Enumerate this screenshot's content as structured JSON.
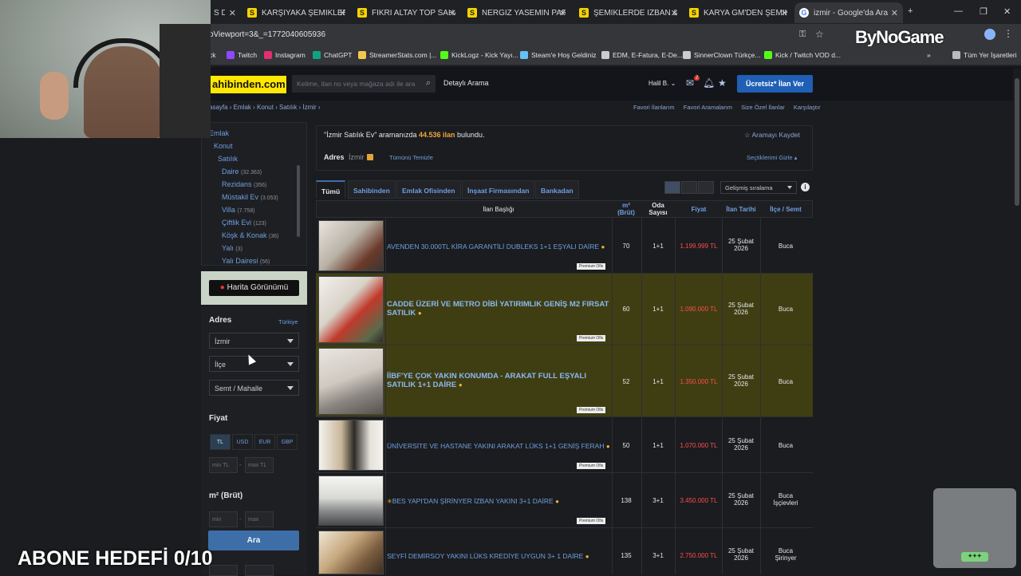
{
  "tabs": [
    {
      "label": "S DA",
      "fav": ""
    },
    {
      "label": "KARŞIYAKA ŞEMİKLER DE",
      "fav": "S"
    },
    {
      "label": "FİKRİ ALTAY TOP SAHASI",
      "fav": "S"
    },
    {
      "label": "NERGİZ YASEMİN PARK E",
      "fav": "S"
    },
    {
      "label": "ŞEMİKLERDE İZBAN & AN",
      "fav": "S"
    },
    {
      "label": "KARYA GM'DEN ŞEMİKLER",
      "fav": "S"
    },
    {
      "label": "izmir - Google'da Ara",
      "fav": "G"
    }
  ],
  "window": {
    "add_tab": "+",
    "minimize": "—",
    "restore": "❐",
    "close": "✕"
  },
  "address": {
    "url": "oViewport=3&_=1772040605936"
  },
  "overlay_logo": "ByNoGame",
  "bookmarks": [
    {
      "label": "ck",
      "color": "#35363a"
    },
    {
      "label": "Twitch",
      "color": "#9146ff"
    },
    {
      "label": "Instagram",
      "color": "#e1306c"
    },
    {
      "label": "ChatGPT",
      "color": "#10a37f"
    },
    {
      "label": "StreamerStats.com |...",
      "color": "#f2c94c"
    },
    {
      "label": "KickLogz - Kick Yayı...",
      "color": "#53fc18"
    },
    {
      "label": "Steam'e Hoş Geldiniz",
      "color": "#66c0f4"
    },
    {
      "label": "EDM, E-Fatura, E-De...",
      "color": "#cccccc"
    },
    {
      "label": "SinnerClown Türkçe...",
      "color": "#cccccc"
    },
    {
      "label": "Kick / Twitch VOD d...",
      "color": "#53fc18"
    }
  ],
  "bookmarks_more": "»",
  "bookmarks_all": "Tüm Yer İşaretleri",
  "site": {
    "logo": "ahibinden.com",
    "search_placeholder": "Kelime, ilan no veya mağaza adı ile ara",
    "detail_search": "Detaylı Arama",
    "user": "Halil B.",
    "notifications": "7",
    "free_ad": "Ücretsiz* İlan Ver"
  },
  "breadcrumb": "asayfa › Emlak › Konut › Satılık › İzmir ›",
  "top_links": [
    "Favori İlanlarım",
    "Favori Aramalarım",
    "Size Özel İlanlar",
    "Karşılaştır"
  ],
  "categories": [
    {
      "label": "Emlak",
      "count": ""
    },
    {
      "label": "Konut",
      "count": ""
    },
    {
      "label": "Satılık",
      "count": ""
    },
    {
      "label": "Daire",
      "count": "(32.363)"
    },
    {
      "label": "Rezidans",
      "count": "(356)"
    },
    {
      "label": "Müstakil Ev",
      "count": "(3.053)"
    },
    {
      "label": "Villa",
      "count": "(7.758)"
    },
    {
      "label": "Çiftlik Evi",
      "count": "(123)"
    },
    {
      "label": "Köşk & Konak",
      "count": "(36)"
    },
    {
      "label": "Yalı",
      "count": "(3)"
    },
    {
      "label": "Yalı Dairesi",
      "count": "(56)"
    }
  ],
  "map_button": "Harita Görünümü",
  "filters": {
    "address_label": "Adres",
    "country_link": "Türkiye",
    "city": "İzmir",
    "district": "İlçe",
    "neighborhood": "Semt / Mahalle",
    "price_label": "Fiyat",
    "currencies": [
      "TL",
      "USD",
      "EUR",
      "GBP"
    ],
    "min_tl": "min TL",
    "max_tl": "max TL",
    "area_label": "m² (Brüt)",
    "min": "min",
    "max": "max",
    "search_button": "Ara"
  },
  "results": {
    "query": "\"İzmir Satılık Ev\"",
    "middle": "aramanızda",
    "count": "44.536 ilan",
    "suffix": "bulundu.",
    "save_search": "Aramayı Kaydet",
    "address_label": "Adres",
    "address_value": "İzmir",
    "clear_all": "Tümünü Temizle",
    "hide_selections": "Seçtiklerimi Gizle"
  },
  "listing_tabs": [
    "Tümü",
    "Sahibinden",
    "Emlak Ofisinden",
    "İnşaat Firmasından",
    "Bankadan"
  ],
  "sort": "Gelişmiş sıralama",
  "columns": {
    "title": "İlan Başlığı",
    "area": "m² (Brüt)",
    "rooms": "Oda Sayısı",
    "price": "Fiyat",
    "date": "İlan Tarihi",
    "location": "İlçe / Semt"
  },
  "badge_label": "Premium Ofis",
  "listings": [
    {
      "title": "AVENDEN 30.000TL KİRA GARANTİLİ DUBLEKS 1+1 EŞYALI DAİRE",
      "area": "70",
      "rooms": "1+1",
      "price": "1.199.999 TL",
      "date1": "25 Şubat",
      "date2": "2026",
      "loc1": "Buca",
      "loc2": "",
      "highlight": false
    },
    {
      "title": "CADDE ÜZERİ VE METRO DİBİ YATIRIMLIK GENİŞ M2 FIRSAT SATILIK",
      "area": "60",
      "rooms": "1+1",
      "price": "1.090.000 TL",
      "date1": "25 Şubat",
      "date2": "2026",
      "loc1": "Buca",
      "loc2": "",
      "highlight": true
    },
    {
      "title": "İİBF'YE ÇOK YAKIN KONUMDA - ARAKAT FULL EŞYALI SATILIK 1+1 DAİRE",
      "area": "52",
      "rooms": "1+1",
      "price": "1.350.000 TL",
      "date1": "25 Şubat",
      "date2": "2026",
      "loc1": "Buca",
      "loc2": "",
      "highlight": true
    },
    {
      "title": "ÜNİVERSİTE VE HASTANE YAKINI ARAKAT LÜKS 1+1 GENİŞ FERAH",
      "area": "50",
      "rooms": "1+1",
      "price": "1.070.000 TL",
      "date1": "25 Şubat",
      "date2": "2026",
      "loc1": "Buca",
      "loc2": "",
      "highlight": false
    },
    {
      "title": "BES YAPI'DAN ŞİRİNYER İZBAN YAKINI 3+1 DAİRE",
      "area": "138",
      "rooms": "3+1",
      "price": "3.450.000 TL",
      "date1": "25 Şubat",
      "date2": "2026",
      "loc1": "Buca",
      "loc2": "İşçievleri",
      "highlight": false
    },
    {
      "title": "SEYFİ DEMİRSOY YAKINI LÜKS KREDİYE UYGUN 3+ 1 DAİRE",
      "area": "135",
      "rooms": "3+1",
      "price": "2.750.000 TL",
      "date1": "25 Şubat",
      "date2": "2026",
      "loc1": "Buca",
      "loc2": "Şirinyer",
      "highlight": false
    }
  ],
  "stream_goal": "ABONE HEDEFİ 0/10",
  "glass_badge": "✦✦✦"
}
